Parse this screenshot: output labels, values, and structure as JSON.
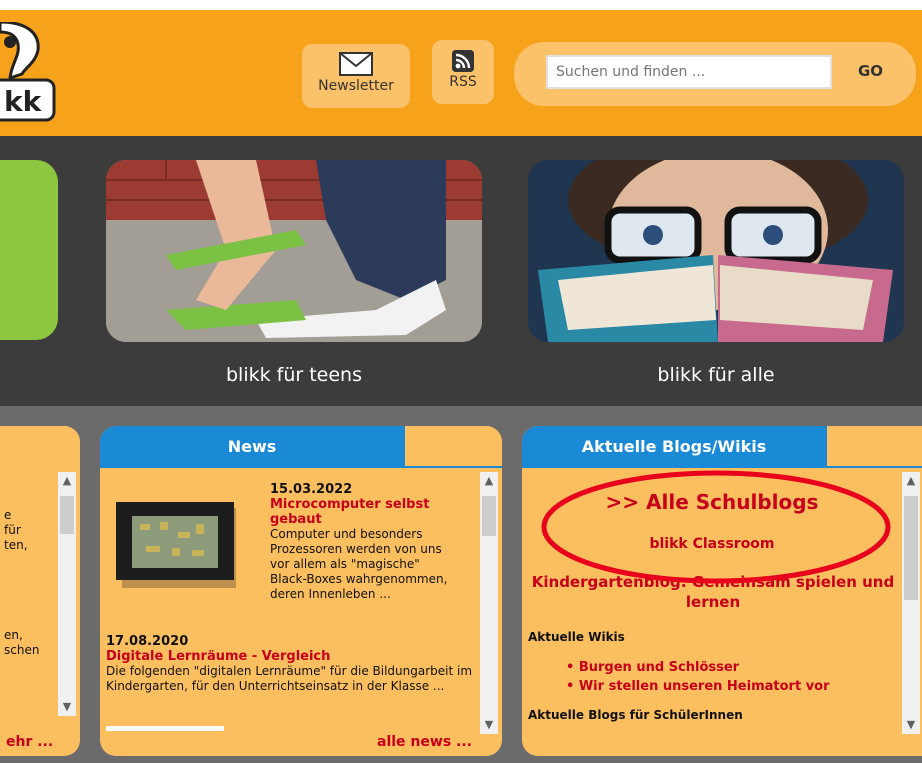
{
  "header": {
    "newsletter_label": "Newsletter",
    "rss_label": "RSS",
    "search_placeholder": "Suchen und finden ...",
    "go_label": "GO",
    "logo_text": "kk"
  },
  "teasers": {
    "teens_label": "blikk für teens",
    "alle_label": "blikk für alle"
  },
  "left_panel": {
    "fragments": [
      "e",
      "für",
      "ten,",
      "en,",
      "schen"
    ],
    "more_link": "ehr ..."
  },
  "news": {
    "tab_label": "News",
    "items": [
      {
        "date": "15.03.2022",
        "title": "Microcomputer selbst gebaut",
        "text": "Computer und besonders Prozessoren werden von uns vor allem als \"magische\" Black-Boxes wahrgenommen, deren Innenleben ..."
      },
      {
        "date": "17.08.2020",
        "title": "Digitale Lernräume - Vergleich",
        "text": "Die folgenden \"digitalen Lernräume\" für die Bildungarbeit im Kindergarten, für den Unterrichtseinsatz in der Klasse ..."
      }
    ],
    "more_link": "alle news ..."
  },
  "blogs": {
    "tab_label": "Aktuelle Blogs/Wikis",
    "all_blogs_link": ">> Alle Schulblogs",
    "classroom_link": "blikk Classroom",
    "kindergarten_link": "Kindergartenblog: Gemeinsam spielen und lernen",
    "wikis_heading": "Aktuelle Wikis",
    "wikis": [
      "Burgen und Schlösser",
      "Wir stellen unseren Heimatort vor"
    ],
    "blogs_students_heading": "Aktuelle Blogs für SchülerInnen"
  },
  "colors": {
    "header_orange": "#f7a21b",
    "panel_orange": "#fbbf60",
    "tab_blue": "#1b8ad6",
    "link_red": "#c7001b",
    "annotation_red": "#e8001c"
  }
}
